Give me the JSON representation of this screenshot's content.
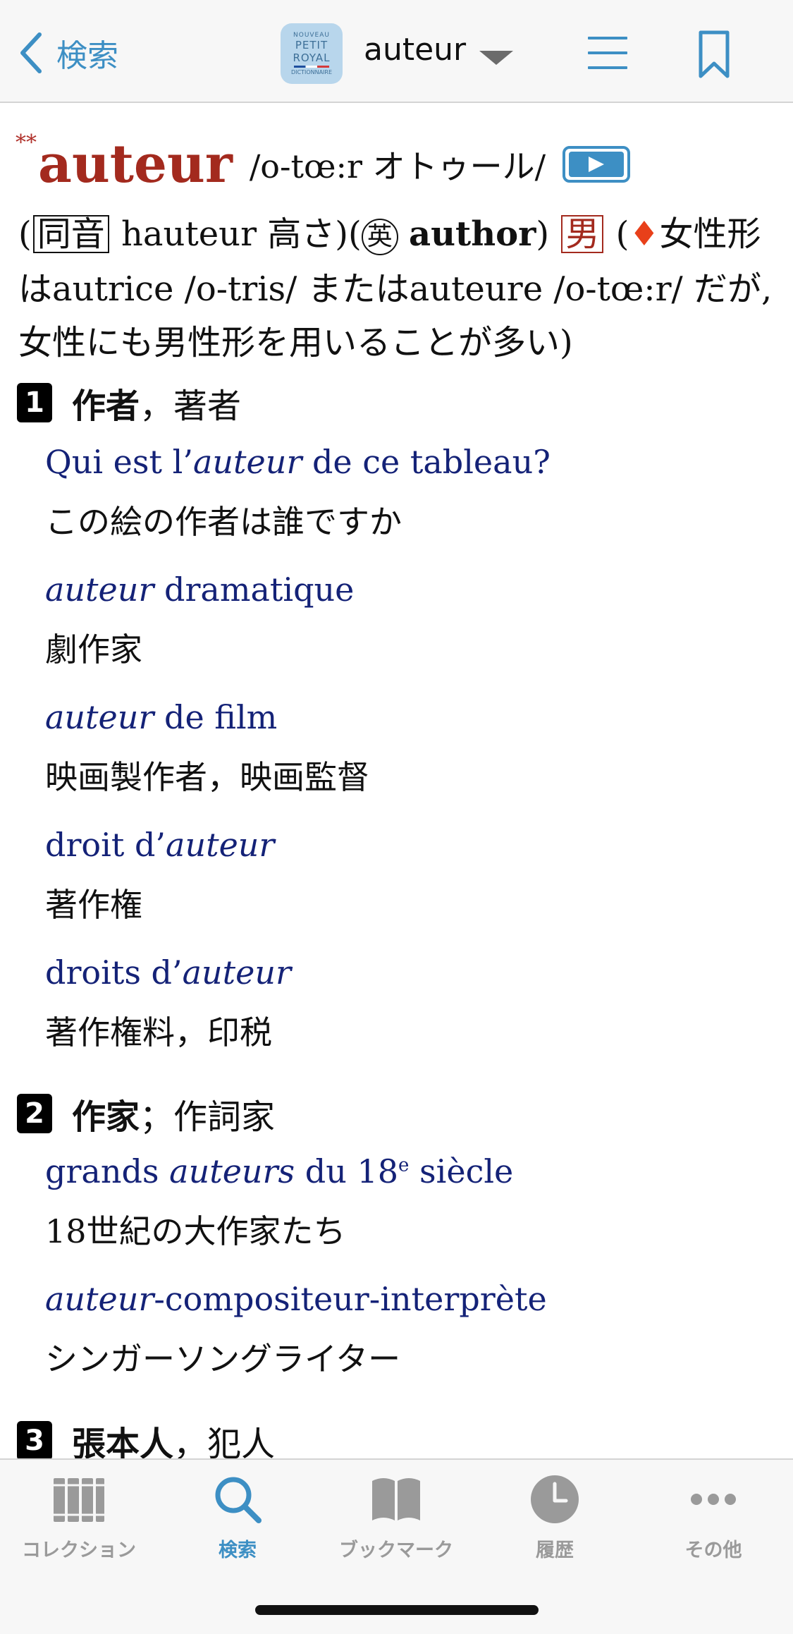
{
  "header": {
    "back_label": "検索",
    "logo": {
      "line1": "NOUVEAU",
      "line2": "PETIT",
      "line3": "ROYAL",
      "line4": "DICTIONNAIRE"
    },
    "word": "auteur"
  },
  "entry": {
    "stars": "**",
    "headword": "auteur",
    "pronunciation": "/o-tœ:r オトゥール/",
    "note": {
      "open_paren": "(",
      "homophone_tag": "同音",
      "homophone_word": "hauteur 高さ",
      "close_paren": ")",
      "english_open": "(",
      "english_tag": "英",
      "english_word": "author",
      "english_close": ")",
      "gender_tag": "男",
      "fem_open": "(",
      "diamond": "♦",
      "line1_rest": "女性形",
      "line2": "はautrice /o-tris/ またはauteure /o-tœ:r/ だが,",
      "line3": "女性にも男性形を用いることが多い)"
    },
    "senses": [
      {
        "number": "1",
        "label_bold": "作者",
        "label_rest": "，著者",
        "examples": [
          {
            "pre": "Qui est l’",
            "italic": "auteur",
            "post": " de ce tableau?",
            "translation": "この絵の作者は誰ですか"
          },
          {
            "pre": "",
            "italic": "auteur",
            "post": " dramatique",
            "translation": "劇作家"
          },
          {
            "pre": "",
            "italic": "auteur",
            "post": " de film",
            "translation": "映画製作者，映画監督"
          },
          {
            "pre": "droit d’",
            "italic": "auteur",
            "post": "",
            "translation": "著作権"
          },
          {
            "pre": "droits d’",
            "italic": "auteur",
            "post": "",
            "translation": "著作権料，印税"
          }
        ]
      },
      {
        "number": "2",
        "label_bold": "作家",
        "label_rest": "；作詞家",
        "examples": [
          {
            "pre": "grands ",
            "italic": "auteurs",
            "post": " du 18",
            "sup": "e",
            "post2": " siècle",
            "translation": "18世紀の大作家たち"
          },
          {
            "pre": "",
            "italic": "auteur",
            "post": "-compositeur-interprète",
            "translation": "シンガーソングライター"
          }
        ]
      },
      {
        "number": "3",
        "label_bold": "張本人",
        "label_rest": "，犯人"
      }
    ]
  },
  "tabbar": {
    "tabs": [
      {
        "label": "コレクション",
        "icon": "books-icon"
      },
      {
        "label": "検索",
        "icon": "search-icon",
        "active": true
      },
      {
        "label": "ブックマーク",
        "icon": "open-book-icon"
      },
      {
        "label": "履歴",
        "icon": "clock-icon"
      },
      {
        "label": "その他",
        "icon": "more-icon"
      }
    ]
  },
  "colors": {
    "accent": "#3d8fc4",
    "headword": "#a32a1e",
    "example": "#142277",
    "diamond": "#e8401a"
  }
}
